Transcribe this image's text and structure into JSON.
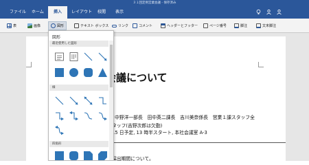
{
  "window": {
    "title": "３１回定例営業会議 - 保存済み",
    "icons": [
      "lightbulb-icon",
      "person-icon",
      "user-account-icon"
    ]
  },
  "tabs": [
    {
      "label": "ファイル"
    },
    {
      "label": "ホーム"
    },
    {
      "label": "挿入"
    },
    {
      "label": "レイアウト"
    },
    {
      "label": "校閲"
    },
    {
      "label": "表示"
    }
  ],
  "ribbon": [
    {
      "label": "表",
      "icon": "table-icon"
    },
    {
      "label": "画像",
      "icon": "picture-icon"
    },
    {
      "label": "図形",
      "icon": "shapes-icon"
    },
    {
      "label": "テキスト ボックス",
      "icon": "textbox-icon"
    },
    {
      "label": "リンク",
      "icon": "link-icon"
    },
    {
      "label": "コメント",
      "icon": "comment-icon"
    },
    {
      "label": "ヘッダーとフッター",
      "icon": "header-footer-icon"
    },
    {
      "label": "ページ番号",
      "icon": "page-number-icon"
    },
    {
      "label": "脚注",
      "icon": "footnote-icon"
    },
    {
      "label": "文末脚注",
      "icon": "endnote-icon"
    }
  ],
  "dropdown": {
    "title": "図形",
    "sections": [
      {
        "label": "最近使用した図形"
      },
      {
        "label": "線"
      },
      {
        "label": "四角形"
      }
    ]
  },
  "document": {
    "heading": "会議について",
    "lines": [
      "中野洋一部長　田中英二課長　吉川美奈係長　営業１課スタッフ全",
      "タッフ(吉野次郎は欠勤)",
      "15 日予定, 13 時半スタート, 本社会議室 A-3",
      "採出期間について。"
    ]
  },
  "colors": {
    "accent": "#2b579a",
    "shape_fill": "#2e75b6",
    "ribbon_bg": "#f3f3f3"
  }
}
